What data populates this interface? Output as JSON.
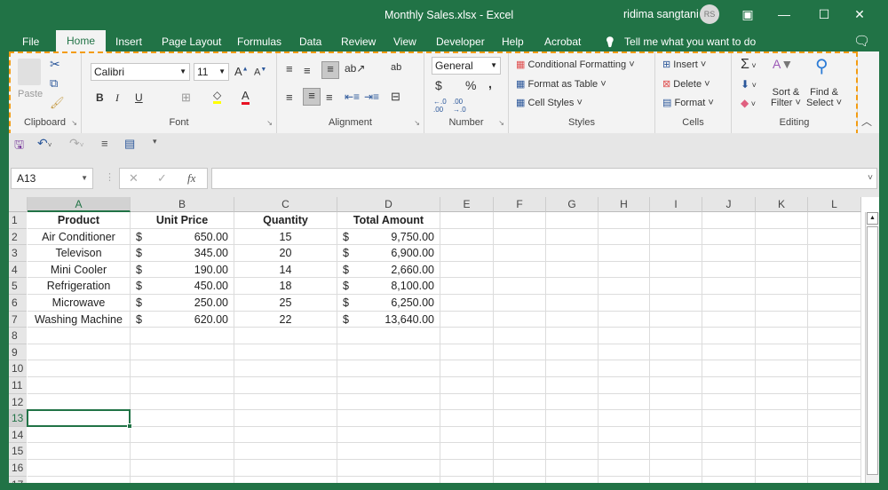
{
  "titlebar": {
    "title": "Monthly Sales.xlsx  -  Excel",
    "user_name": "ridima sangtani",
    "avatar_initials": "RS",
    "ribbon_display_icon": "▣",
    "minimize_icon": "—",
    "maximize_icon": "☐",
    "close_icon": "✕"
  },
  "tabs": [
    {
      "label": "File"
    },
    {
      "label": "Home"
    },
    {
      "label": "Insert"
    },
    {
      "label": "Page Layout"
    },
    {
      "label": "Formulas"
    },
    {
      "label": "Data"
    },
    {
      "label": "Review"
    },
    {
      "label": "View"
    },
    {
      "label": "Developer"
    },
    {
      "label": "Help"
    },
    {
      "label": "Acrobat"
    }
  ],
  "tell_me": {
    "icon": "💡",
    "placeholder": "Tell me what you want to do"
  },
  "comments_icon": "🗨",
  "ribbon": {
    "clipboard": {
      "label": "Clipboard",
      "paste": "Paste"
    },
    "font": {
      "label": "Font",
      "font_name": "Calibri",
      "font_size": "11",
      "bold": "B",
      "italic": "I",
      "underline": "U",
      "fill_color": "#ffff00",
      "font_color": "#e81123"
    },
    "alignment": {
      "label": "Alignment"
    },
    "number": {
      "label": "Number",
      "format": "General",
      "currency": "$",
      "percent": "%",
      "comma": ","
    },
    "styles": {
      "label": "Styles",
      "conditional_formatting": "Conditional Formatting",
      "format_as_table": "Format as Table",
      "cell_styles": "Cell Styles"
    },
    "cells": {
      "label": "Cells",
      "insert": "Insert",
      "delete": "Delete",
      "format": "Format"
    },
    "editing": {
      "label": "Editing",
      "autosum": "Σ",
      "sort_filter_1": "Sort &",
      "sort_filter_2": "Filter",
      "find_select_1": "Find &",
      "find_select_2": "Select"
    }
  },
  "formula_bar": {
    "name_box": "A13",
    "fx": "fx",
    "formula": ""
  },
  "columns": [
    "A",
    "B",
    "C",
    "D",
    "E",
    "F",
    "G",
    "H",
    "I",
    "J",
    "K",
    "L"
  ],
  "active_cell": "A13",
  "rows": [
    {
      "n": "1",
      "a": "Product",
      "b_sym": "",
      "b": "Unit Price",
      "c": "Quantity",
      "d_sym": "",
      "d": "Total Amount",
      "header": true
    },
    {
      "n": "2",
      "a": "Air Conditioner",
      "b_sym": "$",
      "b": "650.00",
      "c": "15",
      "d_sym": "$",
      "d": "9,750.00"
    },
    {
      "n": "3",
      "a": "Televison",
      "b_sym": "$",
      "b": "345.00",
      "c": "20",
      "d_sym": "$",
      "d": "6,900.00"
    },
    {
      "n": "4",
      "a": "Mini Cooler",
      "b_sym": "$",
      "b": "190.00",
      "c": "14",
      "d_sym": "$",
      "d": "2,660.00"
    },
    {
      "n": "5",
      "a": "Refrigeration",
      "b_sym": "$",
      "b": "450.00",
      "c": "18",
      "d_sym": "$",
      "d": "8,100.00"
    },
    {
      "n": "6",
      "a": "Microwave",
      "b_sym": "$",
      "b": "250.00",
      "c": "25",
      "d_sym": "$",
      "d": "6,250.00"
    },
    {
      "n": "7",
      "a": "Washing Machine",
      "b_sym": "$",
      "b": "620.00",
      "c": "22",
      "d_sym": "$",
      "d": "13,640.00"
    },
    {
      "n": "8"
    },
    {
      "n": "9"
    },
    {
      "n": "10"
    },
    {
      "n": "11"
    },
    {
      "n": "12"
    },
    {
      "n": "13"
    },
    {
      "n": "14"
    },
    {
      "n": "15"
    },
    {
      "n": "16"
    },
    {
      "n": "17"
    }
  ]
}
